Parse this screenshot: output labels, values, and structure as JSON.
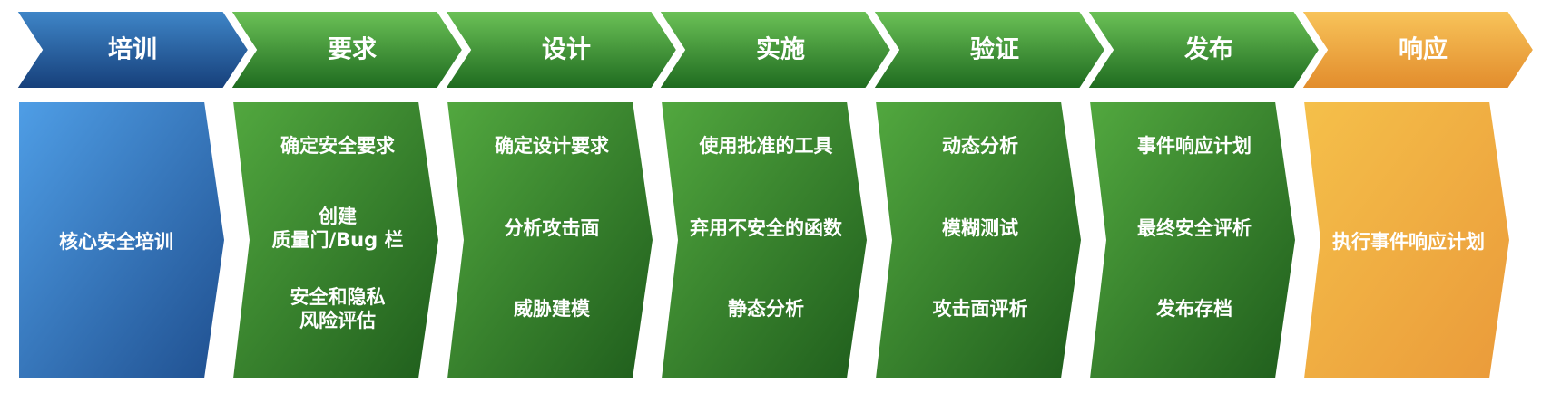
{
  "phases": [
    {
      "title": "培训",
      "color": "blue",
      "items": [
        [
          "核心安全培训"
        ]
      ]
    },
    {
      "title": "要求",
      "color": "green",
      "items": [
        [
          "确定安全要求"
        ],
        [
          "创建",
          "质量门/Bug 栏"
        ],
        [
          "安全和隐私",
          "风险评估"
        ]
      ]
    },
    {
      "title": "设计",
      "color": "green",
      "items": [
        [
          "确定设计要求"
        ],
        [
          "分析攻击面"
        ],
        [
          "威胁建模"
        ]
      ]
    },
    {
      "title": "实施",
      "color": "green",
      "items": [
        [
          "使用批准的工具"
        ],
        [
          "弃用不安全的函数"
        ],
        [
          "静态分析"
        ]
      ]
    },
    {
      "title": "验证",
      "color": "green",
      "items": [
        [
          "动态分析"
        ],
        [
          "模糊测试"
        ],
        [
          "攻击面评析"
        ]
      ]
    },
    {
      "title": "发布",
      "color": "green",
      "items": [
        [
          "事件响应计划"
        ],
        [
          "最终安全评析"
        ],
        [
          "发布存档"
        ]
      ]
    },
    {
      "title": "响应",
      "color": "orange",
      "items": [
        [
          "执行事件响应计划"
        ]
      ]
    }
  ],
  "colors": {
    "blue": {
      "light": "#4f9ee6",
      "dark": "#1f4f8f",
      "head_light": "#3f86c8",
      "head_dark": "#163f7a"
    },
    "green": {
      "light": "#52a83f",
      "dark": "#1f5d1c",
      "head_light": "#6cc257",
      "head_dark": "#1e6a1f"
    },
    "orange": {
      "light": "#f5c04a",
      "dark": "#ea9a3a",
      "head_light": "#f8c45a",
      "head_dark": "#e28c2c"
    }
  }
}
